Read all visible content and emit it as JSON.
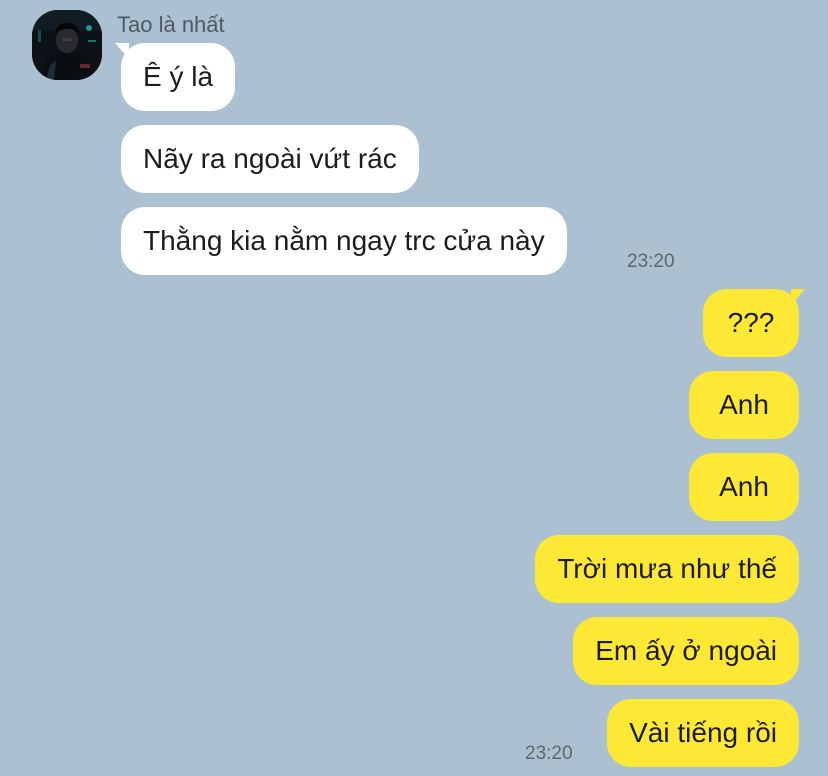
{
  "contact": {
    "name": "Tao là nhất",
    "avatar_icon": "profile-photo"
  },
  "incoming": [
    {
      "text": "Ê ý là"
    },
    {
      "text": "Nãy ra ngoài vứt rác"
    },
    {
      "text": "Thằng kia nằm ngay trc cửa này"
    }
  ],
  "incoming_time": "23:20",
  "outgoing": [
    {
      "text": "???"
    },
    {
      "text": "Anh"
    },
    {
      "text": "Anh"
    },
    {
      "text": "Trời mưa như thế"
    },
    {
      "text": "Em ấy ở ngoài"
    },
    {
      "text": "Vài tiếng rồi"
    }
  ],
  "outgoing_time": "23:20",
  "colors": {
    "background": "#abc1d1",
    "incoming_bubble": "#ffffff",
    "outgoing_bubble": "#fde935"
  }
}
